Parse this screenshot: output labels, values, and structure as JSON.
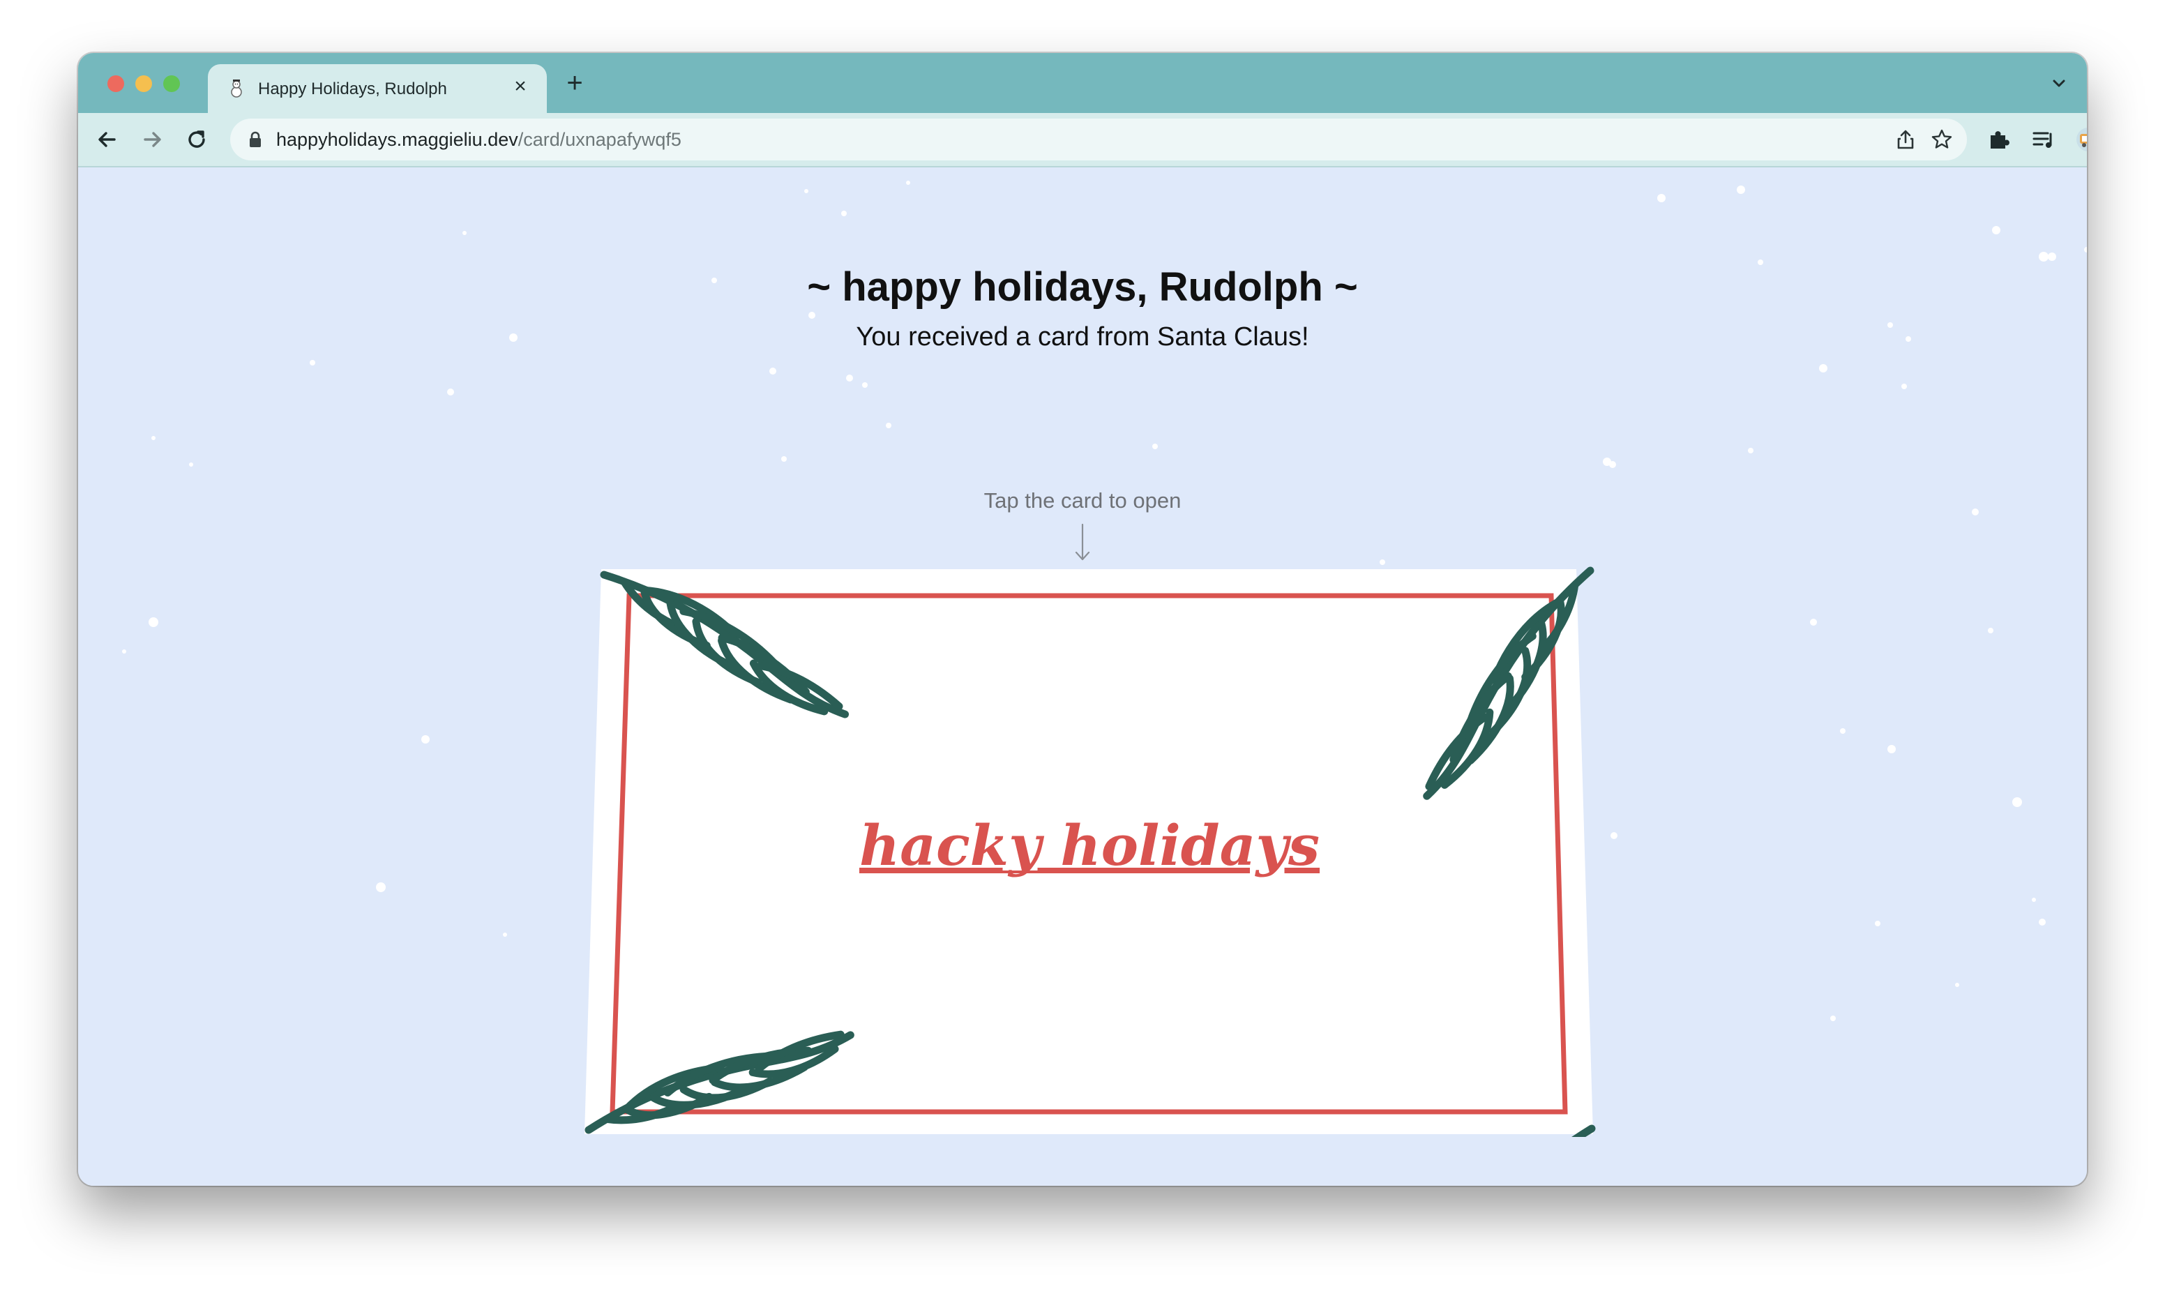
{
  "browser": {
    "tab": {
      "title": "Happy Holidays, Rudolph",
      "favicon": "snowman-icon",
      "close_glyph": "×"
    },
    "new_tab_glyph": "+",
    "address": {
      "host": "happyholidays.maggieliu.dev",
      "path": "/card/uxnapafywqf5"
    },
    "chrome_color": "#75b8bd",
    "toolbar_color": "#d6ecec"
  },
  "page": {
    "heading": "~ happy holidays, Rudolph ~",
    "subheading": "You received a card from Santa Claus!",
    "hint": "Tap the card to open",
    "background": "#dfe9fa"
  },
  "card": {
    "title": "hacky holidays",
    "title_color": "#d9534f",
    "border_color": "#d9534f",
    "branch_color": "#2a5e55",
    "decoration": "pine-branch-icon"
  }
}
